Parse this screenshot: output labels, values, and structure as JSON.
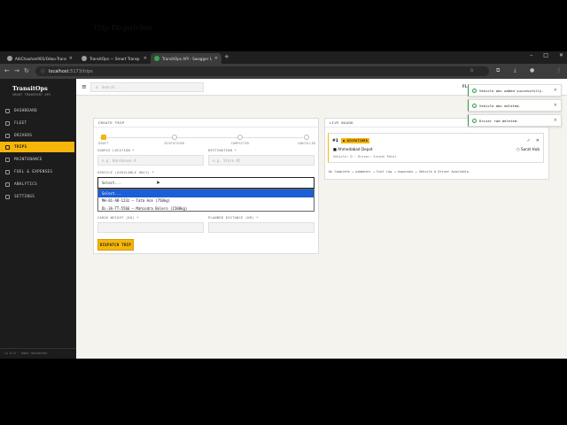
{
  "browser": {
    "tabs": [
      {
        "label": "AdiChauhan901/Odoo-Trans"
      },
      {
        "label": "TransitOps — Smart Transp"
      },
      {
        "label": "TransitOps API - Swagger UI"
      }
    ],
    "new_tab": "+",
    "url_host": "localhost",
    "url_path": ":5173/trips"
  },
  "sidebar": {
    "brand": "TransitOps",
    "brand_sub": "SMART TRANSPORT OPS",
    "items": [
      {
        "label": "DASHBOARD",
        "icon": "grid-icon"
      },
      {
        "label": "FLEET",
        "icon": "truck-icon"
      },
      {
        "label": "DRIVERS",
        "icon": "user-icon"
      },
      {
        "label": "TRIPS",
        "icon": "route-icon",
        "active": true
      },
      {
        "label": "MAINTENANCE",
        "icon": "wrench-icon"
      },
      {
        "label": "FUEL & EXPENSES",
        "icon": "fuel-icon"
      },
      {
        "label": "ANALYTICS",
        "icon": "chart-icon"
      },
      {
        "label": "SETTINGS",
        "icon": "gear-icon"
      }
    ],
    "footer": "v1.0.0 · Odoo Hackathon"
  },
  "topbar": {
    "search_placeholder": "Search...",
    "right_text": "FL"
  },
  "page_title": "Trip Dispatcher",
  "create_trip": {
    "header": "CREATE TRIP",
    "steps": [
      "DRAFT",
      "DISPATCHED",
      "COMPLETED",
      "CANCELLED"
    ],
    "source_label": "SOURCE LOCATION *",
    "source_placeholder": "e.g. Warehouse A",
    "destination_label": "DESTINATION *",
    "destination_placeholder": "e.g. Store #2",
    "vehicle_label": "VEHICLE (AVAILABLE ONLY) *",
    "vehicle_value": "Select...",
    "vehicle_options": [
      "Select...",
      "MH-01-AB-123z — Tata Ace (750kg)",
      "DL-3A-TT-5566 — Mahindra Bolero (1500kg)"
    ],
    "cargo_label": "CARGO WEIGHT (KG) *",
    "distance_label": "PLANNED DISTANCE (KM) *",
    "dispatch_label": "DISPATCH TRIP"
  },
  "live_board": {
    "header": "LIVE BOARD",
    "trip": {
      "id": "#1",
      "status": "● DISPATCHED",
      "origin": "■ Ahmedabad Depot",
      "destination": "○ Surat Hub",
      "meta": "Vehicle: D · Driver: Suresh Patel",
      "actions": [
        "✓",
        "✕"
      ]
    },
    "note": "On Complete → odometer → Fuel log → expenses → Vehicle & Driver Available."
  },
  "toasts": [
    {
      "message": "Vehicle abc added successfully."
    },
    {
      "message": "Vehicle abc deleted."
    },
    {
      "message": "Driver ram deleted."
    }
  ],
  "colors": {
    "accent": "#f5b50a",
    "sidebar_bg": "#1c1c1c",
    "success": "#2e9b4a",
    "select_highlight": "#1a5fd6"
  }
}
